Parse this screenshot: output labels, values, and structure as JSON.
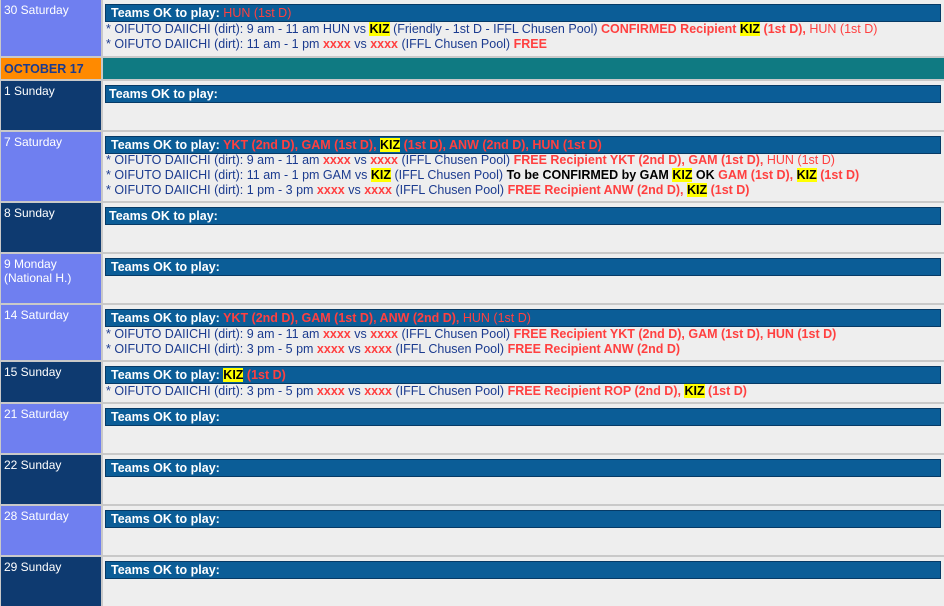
{
  "month_header": "OCTOBER 17",
  "rows": [
    {
      "day": "30 Saturday",
      "ok_label": "Teams OK to play:",
      "ok_teams": " HUN (1st D)",
      "lines": [
        {
          "a": "* OIFUTO DAIICHI (dirt): 9 am - 11 am HUN vs ",
          "kiz": "KIZ",
          "b": " (Friendly - 1st D - IFFL Chusen Pool) ",
          "confirmed": "CONFIRMED Recipient ",
          "kiz2": "KIZ",
          "c": " (1st D),",
          "d": " HUN (1st D)"
        },
        {
          "a": "* OIFUTO DAIICHI (dirt): 11 am - 1 pm ",
          "x1": "xxxx",
          "vs": " vs ",
          "x2": "xxxx",
          "b": " (IFFL Chusen Pool) ",
          "free": "FREE"
        }
      ]
    },
    {
      "day": "1 Sunday",
      "ok_label": "Teams OK to play:"
    },
    {
      "day": "7 Saturday",
      "ok_label": "Teams OK to play: ",
      "ok_teams_a": "YKT (2nd D), GAM (1st D), ",
      "ok_kiz": "KIZ",
      "ok_teams_b": " (1st D), ANW (2nd D), HUN (1st D)",
      "lines": [
        {
          "a": "* OIFUTO DAIICHI (dirt): 9 am - 11 am ",
          "x1": "xxxx",
          "vs": " vs ",
          "x2": "xxxx",
          "b": " (IFFL Chusen Pool) ",
          "free": "FREE Recipient YKT (2nd D), GAM (1st D),",
          "c": " HUN (1st D)"
        },
        {
          "a": "* OIFUTO DAIICHI (dirt): 11 am - 1 pm GAM vs ",
          "kiz": "KIZ",
          "b": " (IFFL Chusen Pool) ",
          "tbc": "To be CONFIRMED by GAM ",
          "kiz2": "KIZ",
          "ok": " OK ",
          "c": "GAM (1st D), ",
          "kiz3": "KIZ",
          "d": " (1st D)"
        },
        {
          "a": "* OIFUTO DAIICHI (dirt): 1 pm - 3 pm ",
          "x1": "xxxx",
          "vs": " vs ",
          "x2": "xxxx",
          "b": " (IFFL Chusen Pool) ",
          "free": "FREE Recipient ANW (2nd D), ",
          "kiz": "KIZ",
          "c": " (1st D)"
        }
      ]
    },
    {
      "day": "8 Sunday",
      "ok_label": "Teams OK to play:"
    },
    {
      "day_line1": "9 Monday",
      "day_line2": "(National H.)",
      "ok_label": "Teams OK to play:"
    },
    {
      "day": "14 Saturday",
      "ok_label": "Teams OK to play: ",
      "ok_teams_a": "YKT (2nd D), GAM (1st D), ANW (2nd D),",
      "ok_teams_b": " HUN (1st D)",
      "lines": [
        {
          "a": "* OIFUTO DAIICHI (dirt): 9 am - 11 am ",
          "x1": "xxxx",
          "vs": " vs ",
          "x2": "xxxx",
          "b": " (IFFL Chusen Pool) ",
          "free": "FREE Recipient YKT (2nd D), GAM (1st D), HUN (1st D)"
        },
        {
          "a": "* OIFUTO DAIICHI (dirt): 3 pm - 5 pm ",
          "x1": "xxxx",
          "vs": " vs ",
          "x2": "xxxx",
          "b": " (IFFL Chusen Pool) ",
          "free": "FREE Recipient ANW (2nd D)"
        }
      ]
    },
    {
      "day": "15 Sunday",
      "ok_label": "Teams OK to play: ",
      "ok_kiz": "KIZ",
      "ok_teams_b": " (1st D)",
      "lines": [
        {
          "a": "* OIFUTO DAIICHI (dirt): 3 pm - 5 pm ",
          "x1": "xxxx",
          "vs": " vs ",
          "x2": "xxxx",
          "b": " (IFFL Chusen Pool) ",
          "free": "FREE Recipient ROP (2nd D), ",
          "kiz": "KIZ",
          "c": " (1st D)"
        }
      ]
    },
    {
      "day": "21 Saturday",
      "ok_label": "Teams OK to play:"
    },
    {
      "day": "22 Sunday",
      "ok_label": "Teams OK to play:"
    },
    {
      "day": "28 Saturday",
      "ok_label": "Teams OK to play:"
    },
    {
      "day": "29 Sunday",
      "ok_label": "Teams OK to play:"
    }
  ],
  "colors": {
    "saturday_cell": "#6f7ff0",
    "sunday_cell": "#0e3a70",
    "month_cell": "#ff8a00",
    "month_bar": "#0f7a82",
    "teams_bar": "#0b5d97",
    "highlight": "#ffff00",
    "red_text": "#ff4040"
  }
}
